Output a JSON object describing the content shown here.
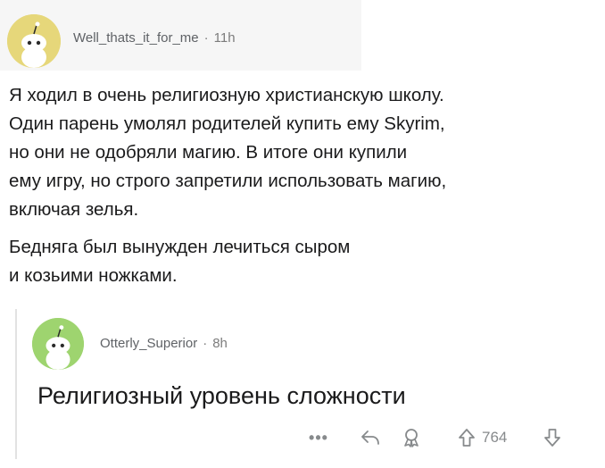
{
  "post": {
    "username": "Well_thats_it_for_me",
    "separator": "·",
    "time": "11h",
    "avatar_icon": "snoo-avatar-icon",
    "avatar_color": "#e6d77a",
    "paragraphs": {
      "p1": [
        "Я ходил в очень религиозную христианскую школу.",
        "Один парень умолял родителей купить ему Skyrim,",
        "но они не одобряли магию. В итоге они купили",
        "ему игру, но строго запретили использовать магию,",
        "включая зелья."
      ],
      "p2": [
        "Бедняга был вынужден лечиться сыром",
        "и козьими ножками."
      ]
    }
  },
  "reply": {
    "username": "Otterly_Superior",
    "separator": "·",
    "time": "8h",
    "avatar_icon": "snoo-avatar-icon",
    "avatar_color": "#9ed46f",
    "text": "Религиозный уровень сложности"
  },
  "actions": {
    "more_label": "•••",
    "share_icon": "share-arrow-icon",
    "award_icon": "award-icon",
    "upvote_icon": "upvote-arrow-icon",
    "vote_count": "764",
    "downvote_icon": "downvote-arrow-icon"
  }
}
